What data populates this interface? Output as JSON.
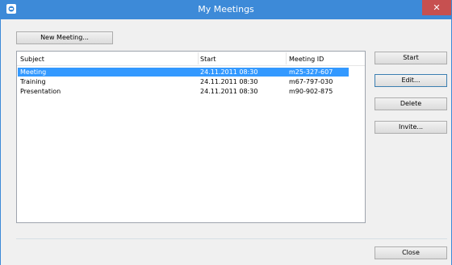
{
  "window": {
    "title": "My Meetings",
    "close_glyph": "✕",
    "icon": "meeting-app-icon"
  },
  "buttons": {
    "new_meeting": "New Meeting...",
    "start": "Start",
    "edit": "Edit...",
    "delete": "Delete",
    "invite": "Invite...",
    "close": "Close"
  },
  "table": {
    "columns": [
      "Subject",
      "Start",
      "Meeting ID"
    ],
    "rows": [
      {
        "subject": "Meeting",
        "start": "24.11.2011 08:30",
        "meeting_id": "m25-327-607",
        "selected": true
      },
      {
        "subject": "Training",
        "start": "24.11.2011 08:30",
        "meeting_id": "m67-797-030",
        "selected": false
      },
      {
        "subject": "Presentation",
        "start": "24.11.2011 08:30",
        "meeting_id": "m90-902-875",
        "selected": false
      }
    ]
  },
  "colors": {
    "selection": "#3399ff",
    "titlebar": "#3d8ad8",
    "close": "#c75050"
  }
}
